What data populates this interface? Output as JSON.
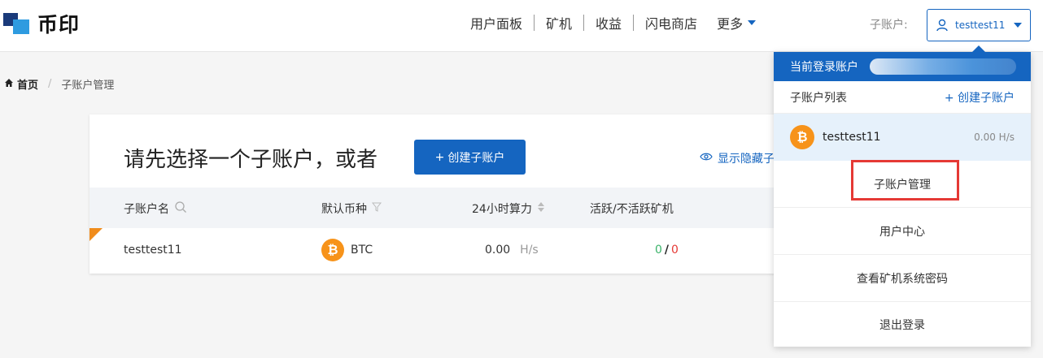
{
  "logo": {
    "text": "币印"
  },
  "nav": {
    "items": [
      "用户面板",
      "矿机",
      "收益",
      "闪电商店"
    ],
    "more_label": "更多"
  },
  "header": {
    "sub_account_label": "子账户:",
    "current_account": "testtest11"
  },
  "breadcrumb": {
    "home": "首页",
    "current": "子账户管理"
  },
  "card": {
    "title": "请先选择一个子账户，或者",
    "create_button": "创建子账户",
    "create_icon": "+",
    "show_hidden": "显示隐藏子",
    "columns": {
      "name": "子账户名",
      "coin": "默认币种",
      "hashrate": "24小时算力",
      "workers": "活跃/不活跃矿机"
    },
    "rows": [
      {
        "name": "testtest11",
        "coin": "BTC",
        "hashrate_value": "0.00",
        "hashrate_unit": "H/s",
        "active": "0",
        "separator": "/",
        "inactive": "0"
      }
    ]
  },
  "dropdown": {
    "current_login": "当前登录账户",
    "list_title": "子账户列表",
    "create": "+ 创建子账户",
    "account": {
      "name": "testtest11",
      "hashrate": "0.00 H/s"
    },
    "items": [
      "子账户管理",
      "用户中心",
      "查看矿机系统密码",
      "退出登录"
    ]
  },
  "colors": {
    "primary": "#1565c0",
    "bitcoin": "#f7931a",
    "highlight": "#e53935",
    "active_green": "#3bb36a"
  },
  "icons": {
    "home": "home-icon",
    "user": "user-icon",
    "search": "search-icon",
    "filter": "filter-icon",
    "sort": "sort-icon",
    "eye": "eye-icon",
    "bitcoin": "bitcoin-icon"
  }
}
